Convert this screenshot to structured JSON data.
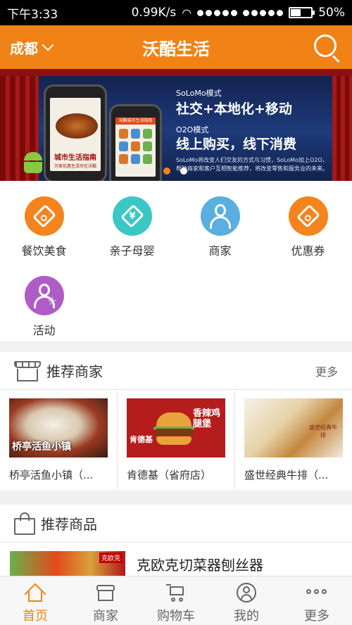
{
  "status_bar": {
    "time": "下午3:33",
    "speed": "0.99K/s",
    "battery": "50%",
    "battery_level": 0.5
  },
  "header": {
    "city": "成都",
    "title": "沃酷生活"
  },
  "banner": {
    "line1": "SoLoMo模式",
    "line2": "社交+本地化+移动",
    "line3": "O2O模式",
    "line4": "线上购买，线下消费",
    "line5": "SoLoMo将改变人们交友的方式与习惯，SoLoMo加上O2O，帮助商家和客户互相智能推荐，将改变零售和服务业的未来。",
    "phone_caption": "城市生活指南",
    "phone_sub": "万家优惠生活尽在沃酷",
    "phone2_bar": "沃酷城市生活指南"
  },
  "categories": [
    {
      "label": "餐饮美食",
      "color": "#f5841f",
      "icon": "tag-icon"
    },
    {
      "label": "亲子母婴",
      "color": "#3bc7c4",
      "icon": "price-tag-icon",
      "glyph": "¥"
    },
    {
      "label": "商家",
      "color": "#5aaee0",
      "icon": "merchant-person-icon"
    },
    {
      "label": "优惠券",
      "color": "#f5841f",
      "icon": "coupon-tag-icon"
    },
    {
      "label": "活动",
      "color": "#b05cc7",
      "icon": "activity-star-icon",
      "glyph": "☆"
    }
  ],
  "recommended_merchants": {
    "title": "推荐商家",
    "more": "更多",
    "items": [
      {
        "name": "桥亭活鱼小镇（...",
        "image_text": "桥亭活鱼小镇"
      },
      {
        "name": "肯德基（省府店）",
        "image_brand": "肯德基",
        "image_promo": "香辣鸡腿堡"
      },
      {
        "name": "盛世经典牛排（...",
        "image_logo": "盛世经典牛排"
      }
    ]
  },
  "recommended_goods": {
    "title": "推荐商品",
    "items": [
      {
        "name": "克欧克切菜器刨丝器",
        "badge": "克欧克"
      }
    ]
  },
  "tabbar": [
    {
      "label": "首页",
      "icon": "home-icon",
      "active": true
    },
    {
      "label": "商家",
      "icon": "store-icon",
      "active": false
    },
    {
      "label": "购物车",
      "icon": "cart-icon",
      "active": false
    },
    {
      "label": "我的",
      "icon": "profile-icon",
      "active": false
    },
    {
      "label": "更多",
      "icon": "more-icon",
      "active": false
    }
  ],
  "colors": {
    "brand": "#f08216",
    "tab_inactive": "#666666"
  }
}
